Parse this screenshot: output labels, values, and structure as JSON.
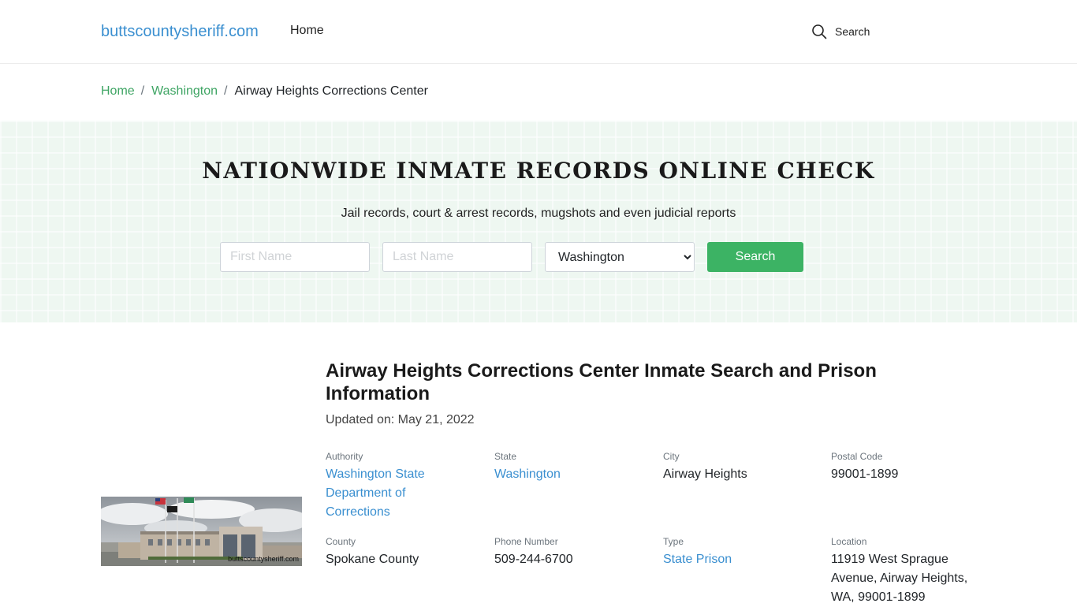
{
  "header": {
    "brand": "buttscountysheriff.com",
    "nav_home": "Home",
    "search_label": "Search"
  },
  "breadcrumb": {
    "items": [
      "Home",
      "Washington"
    ],
    "current": "Airway Heights Corrections Center"
  },
  "hero": {
    "title": "NATIONWIDE INMATE RECORDS ONLINE CHECK",
    "subtitle": "Jail records, court & arrest records, mugshots and even judicial reports",
    "first_name_placeholder": "First Name",
    "last_name_placeholder": "Last Name",
    "state_selected": "Washington",
    "search_button": "Search"
  },
  "facility": {
    "image_watermark": "buttscountysheriff.com",
    "title": "Airway Heights Corrections Center Inmate Search and Prison Information",
    "updated": "Updated on: May 21, 2022",
    "fields": [
      {
        "label": "Authority",
        "value": "Washington State Department of Corrections"
      },
      {
        "label": "State",
        "value": "Washington"
      },
      {
        "label": "City",
        "value": "Airway Heights"
      },
      {
        "label": "Postal Code",
        "value": "99001-1899"
      },
      {
        "label": "County",
        "value": "Spokane County"
      },
      {
        "label": "Phone Number",
        "value": "509-244-6700"
      },
      {
        "label": "Type",
        "value": "State Prison"
      },
      {
        "label": "Location",
        "value": "11919 West Sprague Avenue, Airway Heights, WA, 99001-1899"
      }
    ]
  },
  "colors": {
    "brand_blue": "#3a8fd0",
    "breadcrumb_green": "#3fa564",
    "button_green": "#3cb364",
    "hero_bg": "#eef7f1"
  }
}
